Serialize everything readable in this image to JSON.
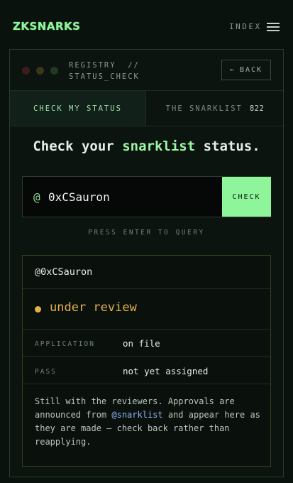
{
  "header": {
    "logo": "ZKSNARKS",
    "index_label": "INDEX",
    "menu_icon": "hamburger-menu-icon"
  },
  "panel": {
    "title_line1": "REGISTRY  //",
    "title_line2": "STATUS_CHECK",
    "back_label": "BACK",
    "back_arrow": "←"
  },
  "tabs": [
    {
      "label": "CHECK MY STATUS",
      "active": true
    },
    {
      "label": "THE SNARKLIST",
      "count": "822",
      "active": false
    }
  ],
  "headline": {
    "prefix": "Check your ",
    "highlight": "snarklist",
    "suffix": " status."
  },
  "query": {
    "prefix": "@",
    "value": "0xCSauron",
    "button_label": "CHECK",
    "hint": "PRESS ENTER TO QUERY"
  },
  "result": {
    "handle": "@0xCSauron",
    "status": "under review",
    "rows": [
      {
        "label": "APPLICATION",
        "value": "on file"
      },
      {
        "label": "PASS",
        "value": "not yet assigned"
      }
    ],
    "note_before": "Still with the reviewers. Approvals are announced from ",
    "note_mention": "@snarklist",
    "note_after": " and appear here as they are made — check back rather than reapplying."
  },
  "colors": {
    "accent_green": "#8ff59a",
    "status_amber": "#e3b04b",
    "mention_blue": "#8fb2f5",
    "background": "#0a120d"
  }
}
